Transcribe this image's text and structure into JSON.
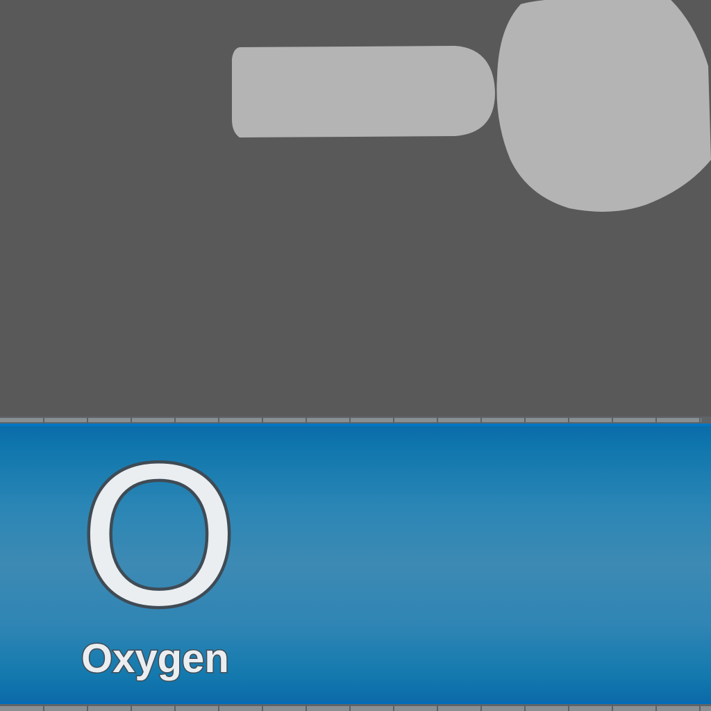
{
  "tile": {
    "symbol": "O",
    "name": "Oxygen"
  },
  "colors": {
    "background": "#595959",
    "placeholder_shape": "#b4b4b4",
    "tile_blue": "#2b86b5",
    "symbol_fill": "#eaeef1",
    "symbol_outline": "#3f4b55"
  }
}
